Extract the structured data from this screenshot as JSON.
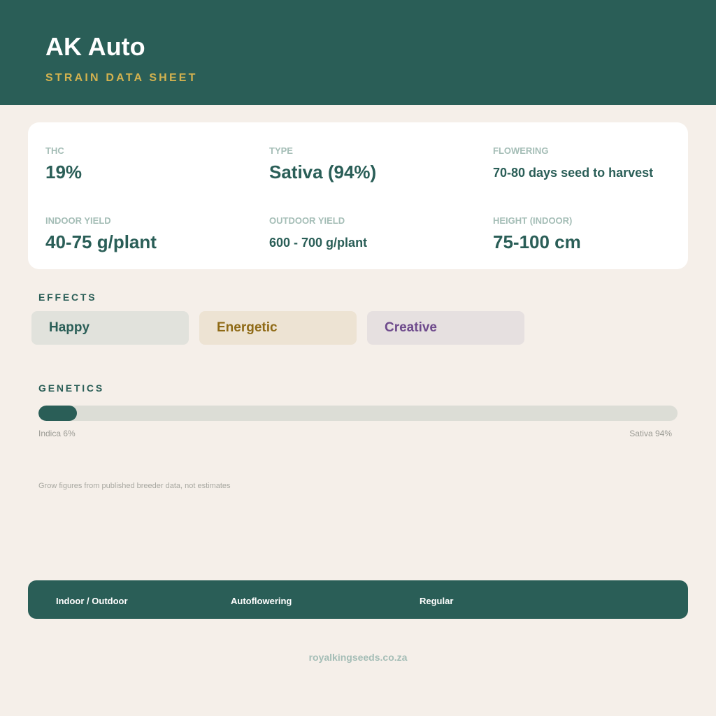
{
  "header": {
    "title": "AK Auto",
    "subtitle": "STRAIN DATA SHEET"
  },
  "stats": {
    "thc": {
      "label": "THC",
      "value": "19%"
    },
    "type": {
      "label": "TYPE",
      "value": "Sativa (94%)"
    },
    "flowering": {
      "label": "FLOWERING",
      "value": "70-80 days seed to harvest"
    },
    "indoor_yield": {
      "label": "INDOOR YIELD",
      "value": "40-75 g/plant"
    },
    "outdoor_yield": {
      "label": "OUTDOOR YIELD",
      "value": "600 - 700 g/plant"
    },
    "height": {
      "label": "HEIGHT (INDOOR)",
      "value": "75-100 cm"
    }
  },
  "effects": {
    "title": "EFFECTS",
    "items": [
      {
        "label": "Happy",
        "bg": "#e1e2dc",
        "color": "#2a5e57"
      },
      {
        "label": "Energetic",
        "bg": "#ede3d3",
        "color": "#8f6a16"
      },
      {
        "label": "Creative",
        "bg": "#e6e0e0",
        "color": "#6e4a8c"
      }
    ]
  },
  "genetics": {
    "title": "GENETICS",
    "indica_percent": 6,
    "sativa_percent": 94,
    "indica_label": "Indica 6%",
    "sativa_label": "Sativa 94%"
  },
  "note": "Grow figures from published breeder data, not estimates",
  "footer": {
    "items": [
      "Indoor / Outdoor",
      "Autoflowering",
      "Regular"
    ]
  },
  "website": "royalkingseeds.co.za",
  "colors": {
    "primary": "#2a5e57",
    "accent": "#d3b24f",
    "background": "#f5efe9"
  }
}
